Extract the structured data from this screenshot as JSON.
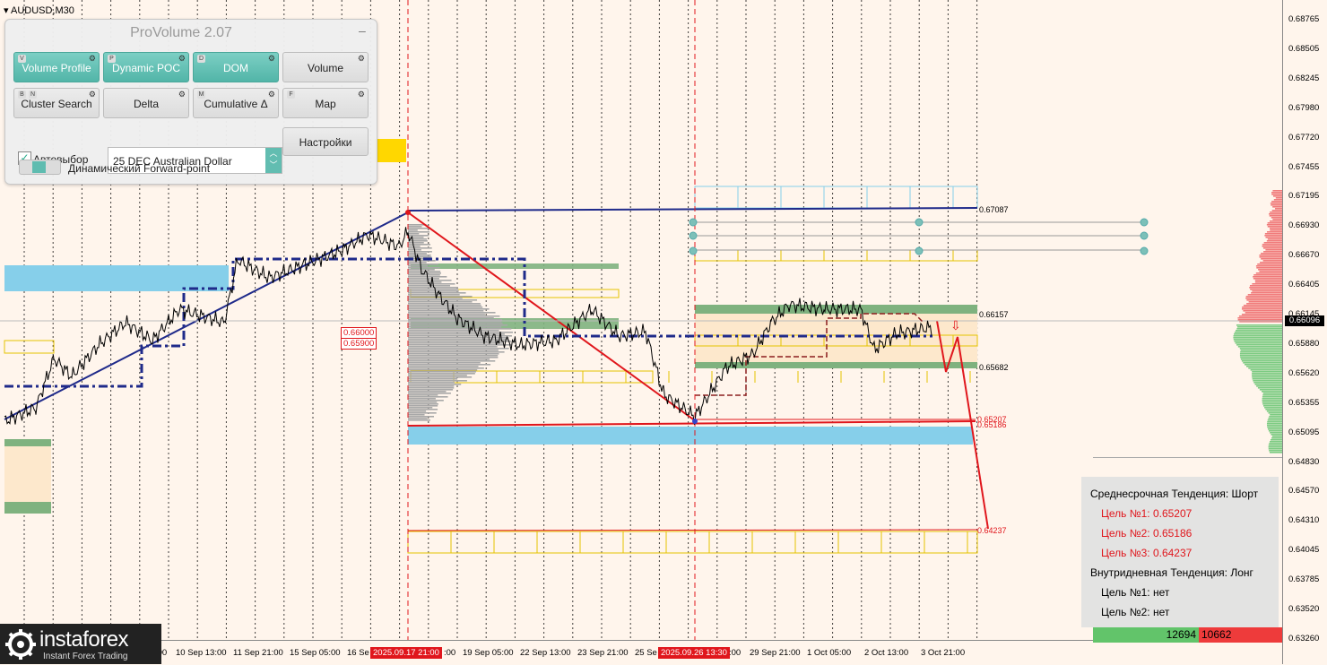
{
  "symbol": "AUDUSD,M30",
  "price_axis": [
    "0.68765",
    "0.68505",
    "0.68245",
    "0.67980",
    "0.67720",
    "0.67455",
    "0.67195",
    "0.66930",
    "0.66670",
    "0.66405",
    "0.66145",
    "0.65880",
    "0.65620",
    "0.65355",
    "0.65095",
    "0.64830",
    "0.64570",
    "0.64310",
    "0.64045",
    "0.63785",
    "0.63520",
    "0.63260"
  ],
  "current_price": "0.66096",
  "time_axis": [
    "10 Sep 13:00",
    "11 Sep 21:00",
    "15 Sep 05:00",
    "16 Se",
    "19 Sep 05:00",
    "22 Sep 13:00",
    "23 Sep 21:00",
    "25 Se",
    "29 Sep 21:00",
    "1 Oct 05:00",
    "2 Oct 13:00",
    "3 Oct 21:00"
  ],
  "time_highlights": [
    "2025.09.17 21:00",
    "2025.09.26 13:30"
  ],
  "time_axis_extras": [
    ":00",
    ":00",
    ":00"
  ],
  "level_labels": {
    "l1": "0.67087",
    "l2": "0.66157",
    "l3": "0.65682",
    "l4": "0.65207",
    "l5": "0.65186",
    "l6": "0.64237"
  },
  "marks": {
    "m1": "0.66000",
    "m2": "0.65900"
  },
  "panel": {
    "title": "ProVolume 2.07",
    "buttons": [
      {
        "label": "Volume Profile",
        "key": "V",
        "on": true
      },
      {
        "label": "Dynamic POC",
        "key": "P",
        "on": true
      },
      {
        "label": "DOM",
        "key": "D",
        "on": true
      },
      {
        "label": "Volume",
        "key": "",
        "on": false
      },
      {
        "label": "Cluster Search",
        "key": "B N",
        "on": false
      },
      {
        "label": "Delta",
        "key": "",
        "on": false
      },
      {
        "label": "Cumulative Δ",
        "key": "M",
        "on": false
      },
      {
        "label": "Map",
        "key": "F",
        "on": false
      }
    ],
    "auto_label": "Автовыбор",
    "instrument": "25 DEC Australian Dollar",
    "settings_label": "Настройки",
    "forward_label": "Динамический Forward-point"
  },
  "info": {
    "mid_trend": "Среднесрочная Тенденция: Шорт",
    "t1": "Цель №1: 0.65207",
    "t2": "Цель №2: 0.65186",
    "t3": "Цель №3: 0.64237",
    "intraday": "Внутридневная Тенденция: Лонг",
    "i1": "Цель №1: нет",
    "i2": "Цель №2: нет"
  },
  "volume": {
    "buy": "12694",
    "sell": "10662"
  },
  "logo": {
    "name": "instaforex",
    "tagline": "Instant Forex Trading"
  },
  "colors": {
    "up_zone": "#86cfea",
    "sell_zone": "#e0161c",
    "buy_hist": "#62c46a",
    "trend": "#1f2a8a"
  }
}
